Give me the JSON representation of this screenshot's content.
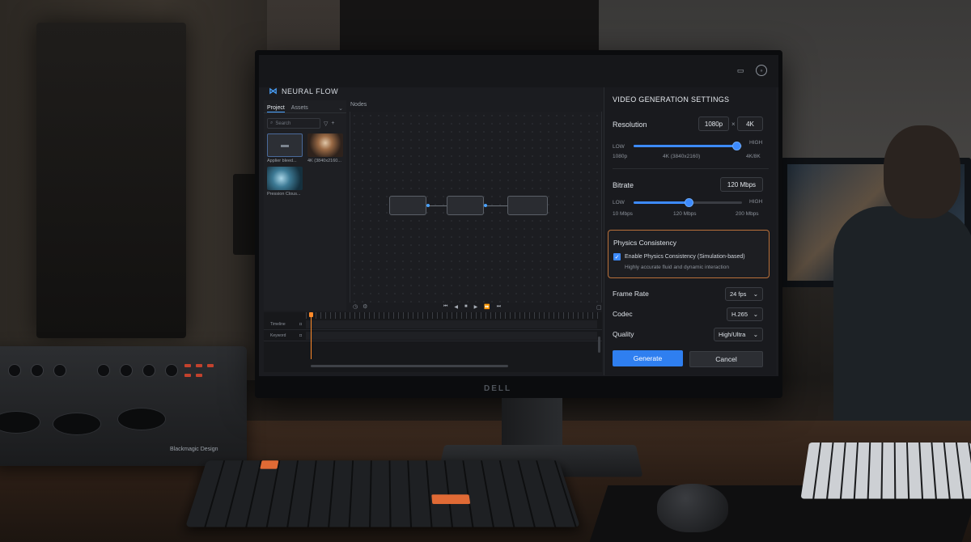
{
  "app": {
    "name": "NEURAL FLOW",
    "icon": "neural-flow-logo-icon"
  },
  "header": {
    "icons": [
      "folder-icon",
      "user-avatar-icon"
    ]
  },
  "left_panel": {
    "tabs": [
      "Project",
      "Assets"
    ],
    "active_tab": "Project",
    "search_placeholder": "Search",
    "assets": [
      {
        "label": "Applier bleed...",
        "type": "folder"
      },
      {
        "label": "4K (3840x2160...",
        "type": "video"
      },
      {
        "label": "Pression Clous...",
        "type": "video"
      }
    ]
  },
  "center": {
    "tab_label": "Nodes"
  },
  "timeline": {
    "tracks": [
      "Timeline",
      "Keyword"
    ]
  },
  "settings": {
    "title": "VIDEO GENERATION SETTINGS",
    "resolution": {
      "label": "Resolution",
      "value_a": "1080p",
      "separator": "×",
      "value_b": "4K",
      "low_label": "LOW",
      "high_label": "HIGH",
      "min_text": "1080p",
      "current_text": "4K (3840x2160)",
      "max_text": "4K/8K",
      "level": 0.95
    },
    "bitrate": {
      "label": "Bitrate",
      "value": "120 Mbps",
      "low_label": "LOW",
      "high_label": "HIGH",
      "min_text": "10 Mbps",
      "current_text": "120 Mbps",
      "max_text": "200 Mbps",
      "level": 0.51
    },
    "physics": {
      "title": "Physics Consistency",
      "checkbox_label": "Enable Physics Consistency (Simulation-based)",
      "checked": true,
      "description": "Highly accurate fluid and dynamic interaction"
    },
    "frame_rate": {
      "label": "Frame Rate",
      "value": "24 fps"
    },
    "codec": {
      "label": "Codec",
      "value": "H.265"
    },
    "quality": {
      "label": "Quality",
      "value": "High/Ultra"
    },
    "generate_label": "Generate",
    "cancel_label": "Cancel",
    "accent_color": "#2f7ff0",
    "highlight_color": "#b9713a"
  },
  "hardware": {
    "monitor_brand": "DELL",
    "console_brand": "Blackmagic Design"
  }
}
